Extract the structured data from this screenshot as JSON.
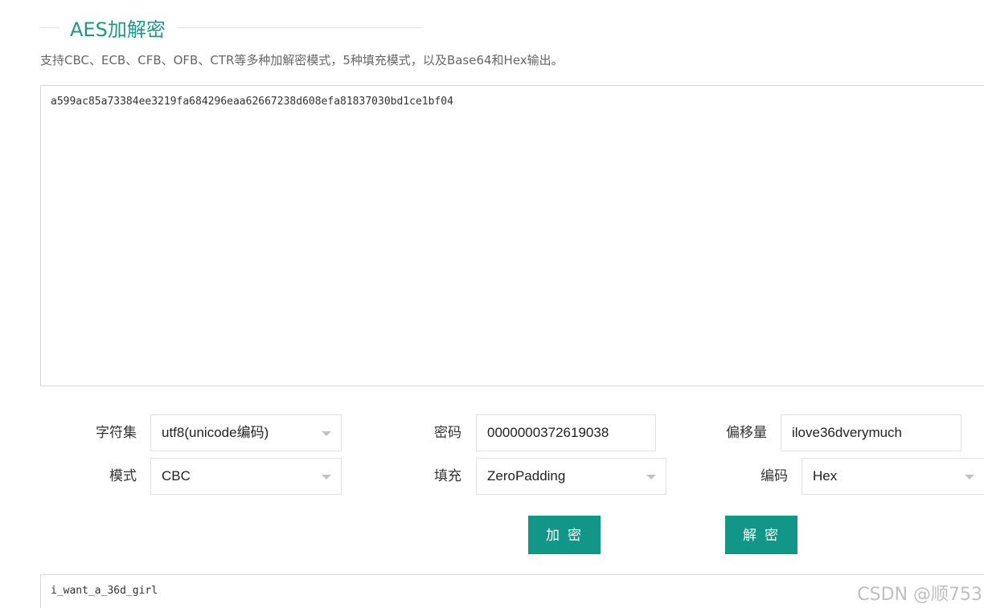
{
  "header": {
    "title": "AES加解密",
    "subtitle": "支持CBC、ECB、CFB、OFB、CTR等多种加解密模式，5种填充模式，以及Base64和Hex输出。"
  },
  "input": {
    "value": "a599ac85a73384ee3219fa684296eaa62667238d608efa81837030bd1ce1bf04"
  },
  "options": {
    "charset": {
      "label": "字符集",
      "value": "utf8(unicode编码)"
    },
    "password": {
      "label": "密码",
      "value": "0000000372619038"
    },
    "iv": {
      "label": "偏移量",
      "value": "ilove36dverymuch"
    },
    "mode": {
      "label": "模式",
      "value": "CBC"
    },
    "padding": {
      "label": "填充",
      "value": "ZeroPadding"
    },
    "encoding": {
      "label": "编码",
      "value": "Hex"
    }
  },
  "actions": {
    "encrypt_label": "加密",
    "decrypt_label": "解密"
  },
  "output": {
    "value": "i_want_a_36d_girl"
  },
  "watermark": "CSDN @顺753",
  "colors": {
    "accent": "#129687",
    "title": "#1a998a",
    "border": "#d9d9d9"
  }
}
